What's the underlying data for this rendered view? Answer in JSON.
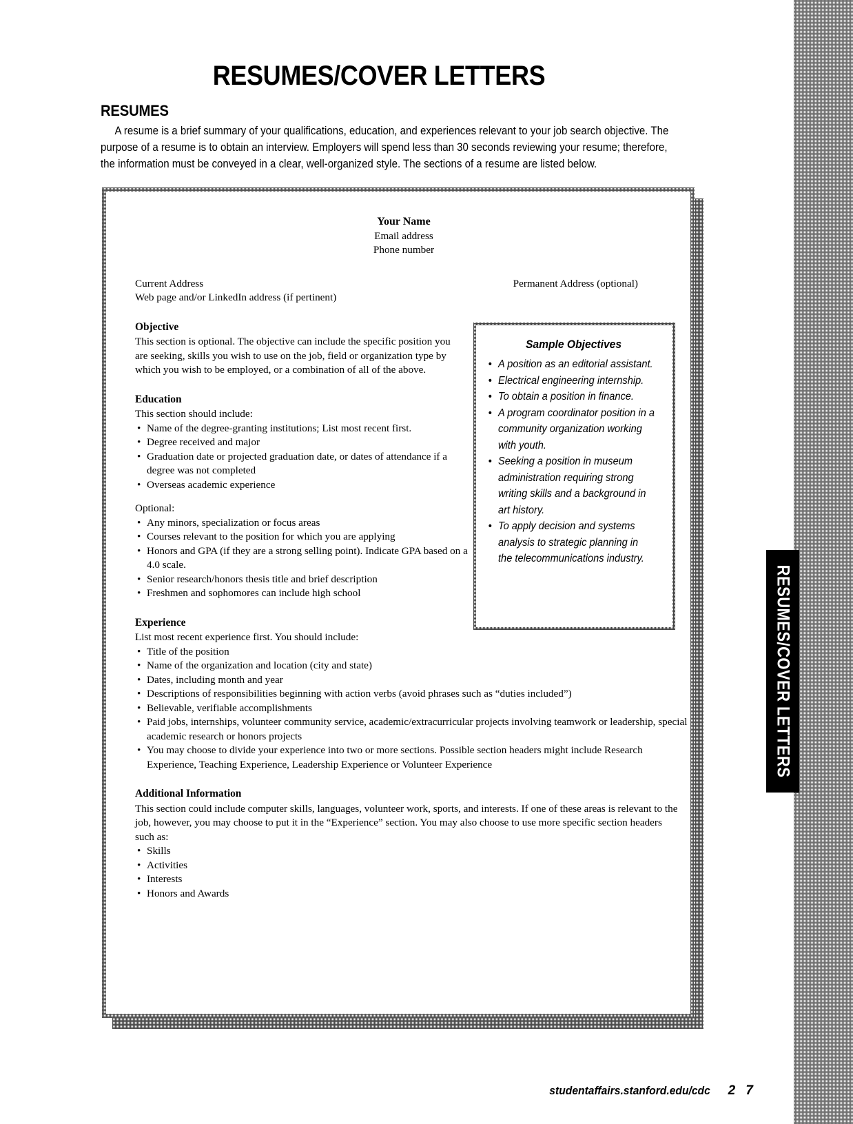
{
  "document": {
    "title": "RESUMES/COVER LETTERS",
    "side_tab_label": "RESUMES/COVER LETTERS"
  },
  "intro": {
    "heading": "RESUMES",
    "paragraph": "A resume is a brief summary of your qualifications, education, and experiences relevant to your job search objective. The purpose of a resume is to obtain an interview. Employers will spend less than 30 seconds reviewing your resume; therefore, the information must be conveyed in a clear, well-organized style. The sections of a resume are listed below."
  },
  "resume": {
    "header": {
      "name": "Your Name",
      "email": "Email address",
      "phone": "Phone number"
    },
    "address": {
      "current": "Current Address",
      "web": "Web page and/or LinkedIn address (if pertinent)",
      "permanent": "Permanent Address (optional)"
    },
    "objective": {
      "heading": "Objective",
      "body": "This section is optional. The objective can include the specific position you are seeking, skills you wish to use on the job, field or organization type by which you wish to be employed, or a combination of all of the above."
    },
    "education": {
      "heading": "Education",
      "lead": "This section should include:",
      "items": [
        "Name of the degree-granting institutions; List most recent first.",
        "Degree received and major",
        "Graduation date or projected graduation date, or dates of attendance if a degree was not completed",
        "Overseas academic experience"
      ],
      "optional_lead": "Optional:",
      "optional_items": [
        "Any minors, specialization or focus areas",
        "Courses relevant to the position for which you are applying",
        "Honors and GPA (if they are a strong selling point). Indicate GPA based on a 4.0 scale.",
        "Senior research/honors thesis title and brief description",
        "Freshmen and sophomores can include high school"
      ]
    },
    "experience": {
      "heading": "Experience",
      "lead": "List most recent experience first. You should include:",
      "items": [
        "Title of the position",
        "Name of the organization and location (city and state)",
        "Dates, including month and year",
        "Descriptions of responsibilities beginning with action verbs (avoid phrases such as “duties included”)",
        "Believable, verifiable accomplishments",
        "Paid jobs, internships, volunteer community service, academic/extracurricular projects involving teamwork or leadership, special academic research or honors projects",
        "You may choose to divide your experience into two or more sections. Possible section headers might include Research Experience, Teaching Experience, Leadership Experience or Volunteer Experience"
      ]
    },
    "additional": {
      "heading": "Additional Information",
      "body": "This section could include computer skills, languages, volunteer work, sports, and interests. If one of these areas is relevant to the job, however, you may choose to put it in the “Experience” section. You may also choose to use more specific section headers such as:",
      "items": [
        "Skills",
        "Activities",
        "Interests",
        "Honors and Awards"
      ]
    }
  },
  "sample_objectives": {
    "title": "Sample Objectives",
    "items": [
      "A position as an editorial assistant.",
      "Electrical engineering internship.",
      "To obtain a position in finance.",
      "A program coordinator position in a community organization working with youth.",
      "Seeking a position in museum administration requiring strong writing skills and a background in art history.",
      "To apply decision and systems analysis to strategic planning in the telecommunications industry."
    ]
  },
  "footer": {
    "url": "studentaffairs.stanford.edu/cdc",
    "page_number": "2 7"
  }
}
